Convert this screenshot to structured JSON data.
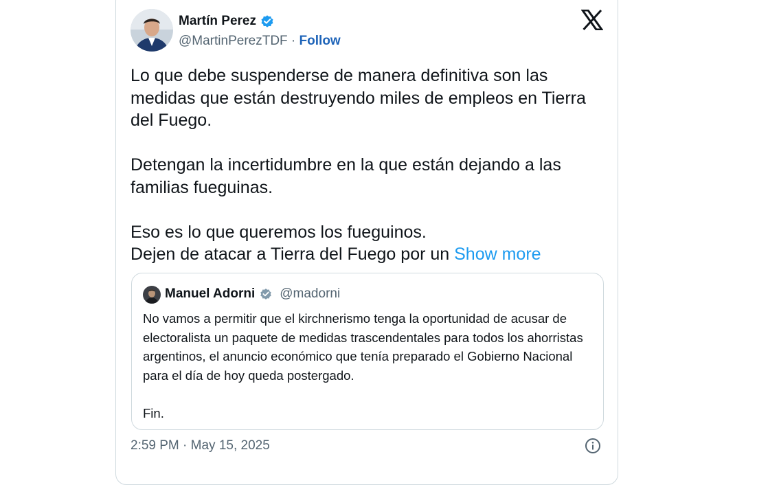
{
  "author": {
    "name": "Martín Perez",
    "handle": "@MartinPerezTDF",
    "separator": " · ",
    "follow_label": "Follow",
    "verified": true
  },
  "brand_icon": "x-logo-icon",
  "tweet": {
    "paragraphs": [
      "Lo que debe suspenderse de manera definitiva son las medidas que están destruyendo miles de empleos en Tierra del Fuego.",
      "Detengan la incertidumbre en la que están dejando a las familias fueguinas.",
      "Eso es lo que queremos los fueguinos."
    ],
    "last_line": "Dejen de atacar a Tierra del Fuego por un ",
    "show_more_label": "Show more"
  },
  "quoted_tweet": {
    "name": "Manuel Adorni",
    "handle": "@madorni",
    "verified_color": "gray",
    "text": "No vamos a permitir que el kirchnerismo tenga la oportunidad de acusar de electoralista un paquete de medidas trascendentales para todos los ahorristas argentinos, el anuncio económico que tenía preparado el Gobierno Nacional para el día de hoy queda postergado.",
    "closing": "Fin."
  },
  "timestamp": "2:59 PM · May 15, 2025",
  "colors": {
    "verified_blue": "#1d9bf0",
    "verified_gray": "#829aab",
    "link_blue": "#1d9bf0",
    "follow_blue": "#1d63b8",
    "secondary_text": "#536471",
    "border": "#cfd9de"
  }
}
